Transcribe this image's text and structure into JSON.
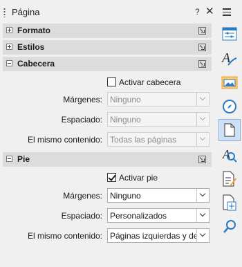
{
  "deck": {
    "title": "Página",
    "help_glyph": "?",
    "close_glyph": "✕"
  },
  "sections": {
    "formato": {
      "label": "Formato",
      "expanded": false
    },
    "estilos": {
      "label": "Estilos",
      "expanded": false
    },
    "cabecera": {
      "label": "Cabecera",
      "expanded": true,
      "activate_label": "Activar cabecera",
      "activate_checked": false,
      "margins_label": "Márgenes:",
      "margins_value": "Ninguno",
      "spacing_label": "Espaciado:",
      "spacing_value": "Ninguno",
      "same_content_label": "El mismo contenido:",
      "same_content_value": "Todas las páginas"
    },
    "pie": {
      "label": "Pie",
      "expanded": true,
      "activate_label": "Activar pie",
      "activate_checked": true,
      "margins_label": "Márgenes:",
      "margins_value": "Ninguno",
      "spacing_label": "Espaciado:",
      "spacing_value": "Personalizados",
      "same_content_label": "El mismo contenido:",
      "same_content_value": "Páginas izquierdas y derechas"
    }
  },
  "tabbar": {
    "icons": [
      "menu-icon",
      "properties-icon",
      "styles-icon",
      "gallery-icon",
      "navigator-icon",
      "page-icon",
      "style-inspector-icon",
      "manage-changes-icon",
      "design-icon",
      "find-icon"
    ],
    "active": "page-icon",
    "accent": "#2a7ac0",
    "warm": "#e8a23a"
  }
}
